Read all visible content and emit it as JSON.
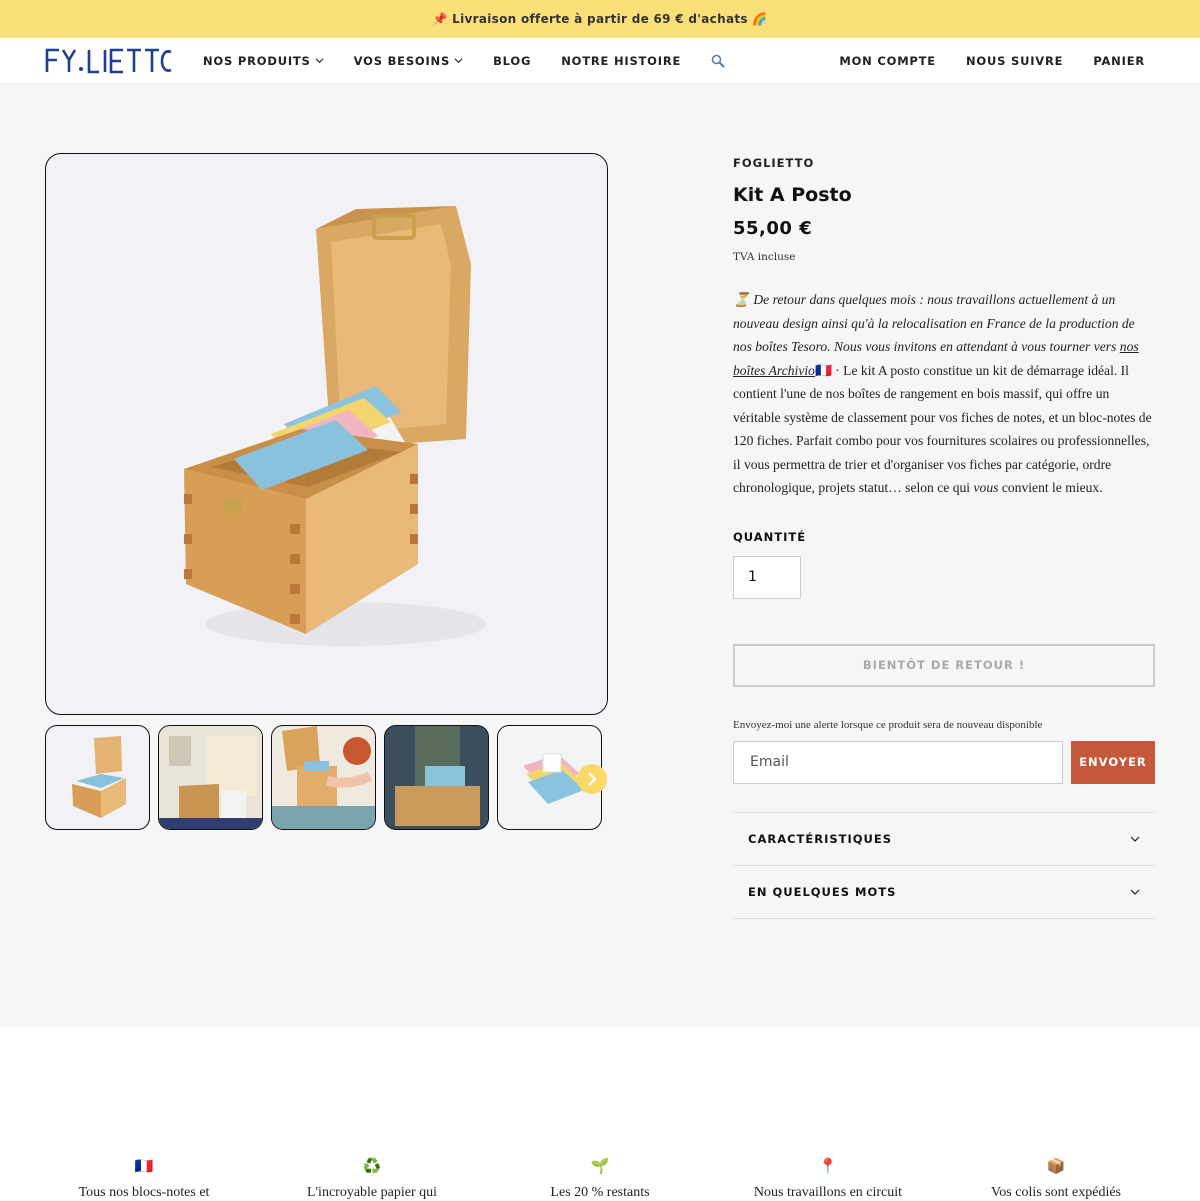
{
  "announcement": "📌 Livraison offerte à partir de 69 € d'achats 🌈",
  "header": {
    "logo_alt": "FOGLIETTO",
    "nav": [
      "NOS PRODUITS",
      "VOS BESOINS",
      "BLOG",
      "NOTRE HISTOIRE"
    ],
    "nav_right": [
      "MON COMPTE",
      "NOUS SUIVRE",
      "PANIER"
    ]
  },
  "product": {
    "vendor": "FOGLIETTO",
    "title": "Kit A Posto",
    "price": "55,00 €",
    "tax_note": "TVA incluse",
    "desc_italic": "⏳ De retour dans quelques mois : nous travaillons actuellement à un nouveau design ainsi qu'à la relocalisation en France de la production de nos boîtes Tesoro. Nous vous invitons en attendant à vous tourner vers",
    "desc_link": "nos boîtes Archivio",
    "desc_rest": "🇫🇷 · Le kit A posto constitue un kit de démarrage idéal. Il contient l'une de nos boîtes de rangement en bois massif, qui offre un véritable système de classement pour vos fiches de notes, et un bloc-notes de 120 fiches. Parfait combo pour vos fournitures scolaires ou professionnelles, il vous permettra de trier et d'organiser vos fiches par catégorie, ordre chronologique, projets statut… selon ce qui",
    "desc_vous": "vous",
    "desc_end": "convient le mieux.",
    "quantity_label": "QUANTITÉ",
    "quantity_value": "1",
    "soldout_label": "BIENTÔT DE RETOUR !",
    "notify_text": "Envoyez-moi une alerte lorsque ce produit sera de nouveau disponible",
    "email_placeholder": "Email",
    "send_label": "ENVOYER",
    "accordion": [
      "CARACTÉRISTIQUES",
      "EN QUELQUES MOTS"
    ]
  },
  "features": [
    {
      "icon": "🇫🇷",
      "text": "Tous nos blocs-notes et"
    },
    {
      "icon": "♻️",
      "text": "L'incroyable papier qui"
    },
    {
      "icon": "🌱",
      "text": "Les 20 % restants"
    },
    {
      "icon": "📍",
      "text": "Nous travaillons en circuit"
    },
    {
      "icon": "📦",
      "text": "Vos colis sont expédiés"
    }
  ],
  "colors": {
    "accent": "#c4583a",
    "announce_bg": "#fbe07a",
    "brand_blue": "#1f3f8f"
  }
}
